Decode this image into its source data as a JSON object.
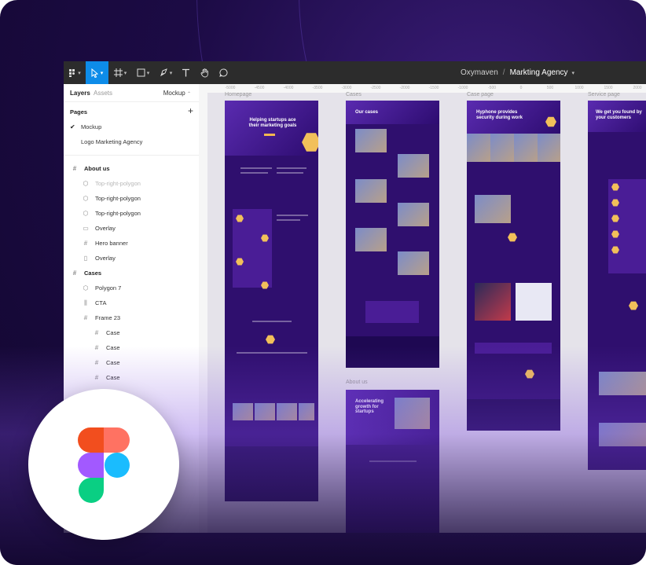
{
  "toolbar": {
    "title_team": "Oxymaven",
    "title_sep": "/",
    "title_file": "Markting Agency"
  },
  "panel": {
    "tabs": {
      "layers": "Layers",
      "assets": "Assets",
      "page": "Mockup"
    },
    "pages_heading": "Pages",
    "add_symbol": "+",
    "pages": [
      {
        "label": "Mockup",
        "selected": true
      },
      {
        "label": "Logo Marketing Agency",
        "selected": false
      }
    ],
    "layers": [
      {
        "label": "About us",
        "icon": "frame-icon",
        "glyph": "#",
        "indent": 0,
        "bold": true
      },
      {
        "label": "Top-right-polygon",
        "icon": "polygon-icon",
        "glyph": "⬡",
        "indent": 1,
        "faded": true
      },
      {
        "label": "Top-right-polygon",
        "icon": "polygon-icon",
        "glyph": "⬡",
        "indent": 1
      },
      {
        "label": "Top-right-polygon",
        "icon": "polygon-icon",
        "glyph": "⬡",
        "indent": 1
      },
      {
        "label": "Overlay",
        "icon": "rectangle-icon",
        "glyph": "▭",
        "indent": 1
      },
      {
        "label": "Hero banner",
        "icon": "frame-icon",
        "glyph": "#",
        "indent": 1
      },
      {
        "label": "Overlay",
        "icon": "rectangle-icon",
        "glyph": "▯",
        "indent": 1
      },
      {
        "label": "Cases",
        "icon": "frame-icon",
        "glyph": "#",
        "indent": 0,
        "bold": true
      },
      {
        "label": "Polygon 7",
        "icon": "polygon-icon",
        "glyph": "⬡",
        "indent": 1
      },
      {
        "label": "CTA",
        "icon": "auto-layout-icon",
        "glyph": "⫼",
        "indent": 1
      },
      {
        "label": "Frame 23",
        "icon": "frame-icon",
        "glyph": "#",
        "indent": 1
      },
      {
        "label": "Case",
        "icon": "frame-icon",
        "glyph": "#",
        "indent": 2
      },
      {
        "label": "Case",
        "icon": "frame-icon",
        "glyph": "#",
        "indent": 2
      },
      {
        "label": "Case",
        "icon": "frame-icon",
        "glyph": "#",
        "indent": 2
      },
      {
        "label": "Case",
        "icon": "frame-icon",
        "glyph": "#",
        "indent": 2
      }
    ]
  },
  "canvas": {
    "ruler_ticks": [
      "-5000",
      "-4500",
      "-4000",
      "-3500",
      "-3000",
      "-2500",
      "-2000",
      "-1500",
      "-1000",
      "-500",
      "0",
      "500",
      "1000",
      "1500",
      "2000"
    ],
    "frames": [
      {
        "label": "Homepage",
        "headline": "Helping startups ace their marketing goals"
      },
      {
        "label": "Cases",
        "headline": "Our cases"
      },
      {
        "label": "Case page",
        "headline": "Hyphone provides security during work"
      },
      {
        "label": "Service page",
        "headline": "We get you found by your customers"
      },
      {
        "label": "About us",
        "headline": "Accelerating growth for startups"
      }
    ]
  },
  "colors": {
    "toolbar": "#2c2c2c",
    "active_tool": "#0d8ce9",
    "mockup_purple": "#2f0f6e",
    "accent_yellow": "#f2c05a"
  }
}
